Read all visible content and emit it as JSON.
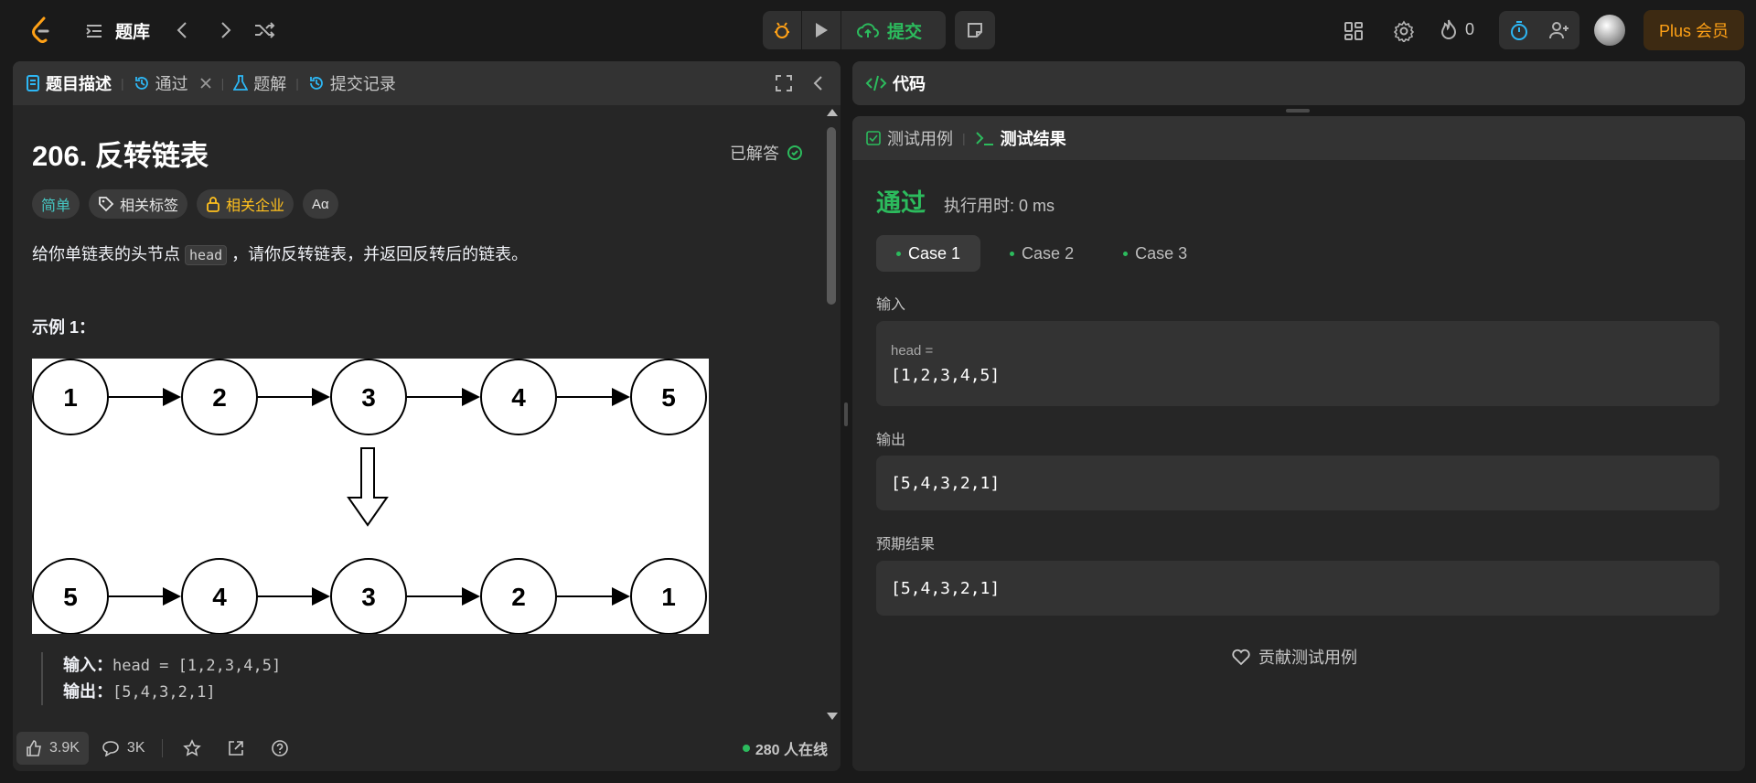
{
  "topbar": {
    "library_label": "题库",
    "submit_label": "提交",
    "streak_count": "0",
    "plus_label": "Plus 会员"
  },
  "left_panel": {
    "tabs": [
      {
        "label": "题目描述"
      },
      {
        "label": "通过"
      },
      {
        "label": "题解"
      },
      {
        "label": "提交记录"
      }
    ],
    "title": "206. 反转链表",
    "solved_label": "已解答",
    "tags": {
      "difficulty": "简单",
      "related_tags": "相关标签",
      "companies": "相关企业",
      "translate": "Aα"
    },
    "description_before": "给你单链表的头节点 ",
    "description_code": "head",
    "description_after": " ，请你反转链表，并返回反转后的链表。",
    "example_title": "示例 1：",
    "diagram": {
      "top_nodes": [
        "1",
        "2",
        "3",
        "4",
        "5"
      ],
      "bottom_nodes": [
        "5",
        "4",
        "3",
        "2",
        "1"
      ]
    },
    "example_input_label": "输入：",
    "example_input_value": "head = [1,2,3,4,5]",
    "example_output_label": "输出：",
    "example_output_value": "[5,4,3,2,1]",
    "footer": {
      "likes": "3.9K",
      "comments": "3K",
      "online": "280 人在线"
    }
  },
  "code_panel": {
    "title": "代码"
  },
  "result_panel": {
    "tabs": [
      {
        "label": "测试用例"
      },
      {
        "label": "测试结果"
      }
    ],
    "status": "通过",
    "runtime": "执行用时: 0 ms",
    "cases": [
      "Case 1",
      "Case 2",
      "Case 3"
    ],
    "input_label": "输入",
    "input_var": "head =",
    "input_value": "[1,2,3,4,5]",
    "output_label": "输出",
    "output_value": "[5,4,3,2,1]",
    "expected_label": "预期结果",
    "expected_value": "[5,4,3,2,1]",
    "contribute_label": "贡献测试用例"
  },
  "colors": {
    "accent_green": "#2cbb5d",
    "easy_teal": "#46c6c2",
    "company_gold": "#ffc01e",
    "plus_orange": "#ffa116",
    "timer_blue": "#2db7f5"
  }
}
